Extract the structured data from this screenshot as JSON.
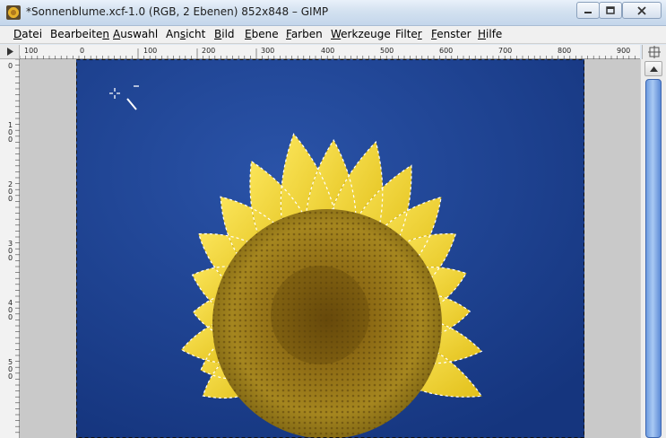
{
  "window": {
    "title": "*Sonnenblume.xcf-1.0 (RGB, 2 Ebenen) 852x848 – GIMP",
    "icon": "gimp-image-icon"
  },
  "menu": [
    {
      "label": "Datei",
      "access": "D"
    },
    {
      "label": "Bearbeiten",
      "access": "n"
    },
    {
      "label": "Auswahl",
      "access": "A"
    },
    {
      "label": "Ansicht",
      "access": "s"
    },
    {
      "label": "Bild",
      "access": "B"
    },
    {
      "label": "Ebene",
      "access": "E"
    },
    {
      "label": "Farben",
      "access": "F"
    },
    {
      "label": "Werkzeuge",
      "access": "W"
    },
    {
      "label": "Filter",
      "access": "r"
    },
    {
      "label": "Fenster",
      "access": "F"
    },
    {
      "label": "Hilfe",
      "access": "H"
    }
  ],
  "rulers": {
    "horizontal_labels": [
      "100",
      "0",
      "100",
      "200",
      "300",
      "400",
      "500",
      "600",
      "700",
      "800",
      "900"
    ],
    "vertical_labels": [
      "0",
      "100",
      "200",
      "300",
      "400",
      "500"
    ]
  },
  "canvas": {
    "image": "sunflower-photo",
    "selection": "marching-ants-around-sunflower",
    "sky_color": "#1d4294",
    "petal_color": "#f0d325",
    "disc_color": "#8a6a12"
  }
}
